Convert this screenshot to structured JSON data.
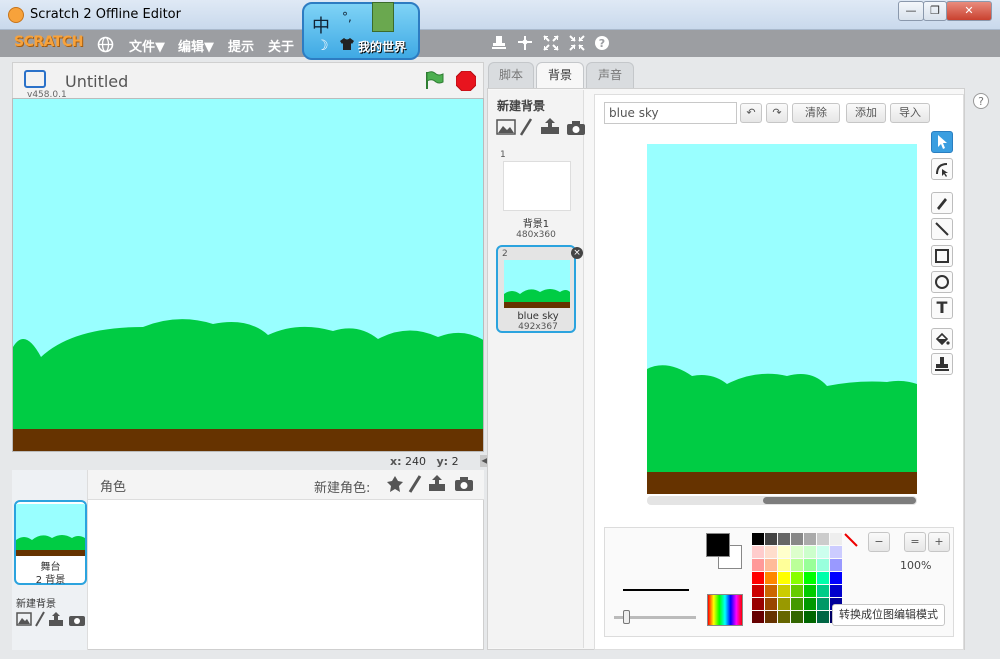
{
  "window": {
    "title": "Scratch 2 Offline Editor",
    "minimize": "—",
    "maximize": "❐",
    "close": "✕"
  },
  "menubar": {
    "logo": "SCRATCH",
    "items": [
      "文件▼",
      "编辑▼",
      "提示",
      "关于"
    ]
  },
  "ime": {
    "char": "中",
    "char2": "°,",
    "moon": "☽",
    "shirt": "👕",
    "game": "我的世界"
  },
  "stage": {
    "project_title": "Untitled",
    "version": "v458.0.1",
    "coords_x_label": "x:",
    "coords_x": "240",
    "coords_y_label": "y:",
    "coords_y": "2"
  },
  "sprites": {
    "label": "角色",
    "new_sprite": "新建角色:",
    "stage_label": "舞台",
    "stage_count": "2 背景",
    "new_backdrop": "新建背景"
  },
  "tabs": [
    "脚本",
    "背景",
    "声音"
  ],
  "backdrops": {
    "new_label": "新建背景",
    "items": [
      {
        "num": "1",
        "name": "背景1",
        "size": "480x360"
      },
      {
        "num": "2",
        "name": "blue sky",
        "size": "492x367"
      }
    ],
    "delete": "×"
  },
  "editor": {
    "name_value": "blue sky",
    "undo": "↶",
    "redo": "↷",
    "clear": "清除",
    "add": "添加",
    "import": "导入",
    "zoom_level": "100%",
    "zoom_out": "−",
    "zoom_reset": "=",
    "zoom_in": "+",
    "bitmap_mode": "转换成位图编辑模式",
    "help": "?"
  },
  "colors": {
    "sky": "#99ffff",
    "grass": "#00cc44",
    "ground": "#663300",
    "accent": "#2ba3de"
  }
}
